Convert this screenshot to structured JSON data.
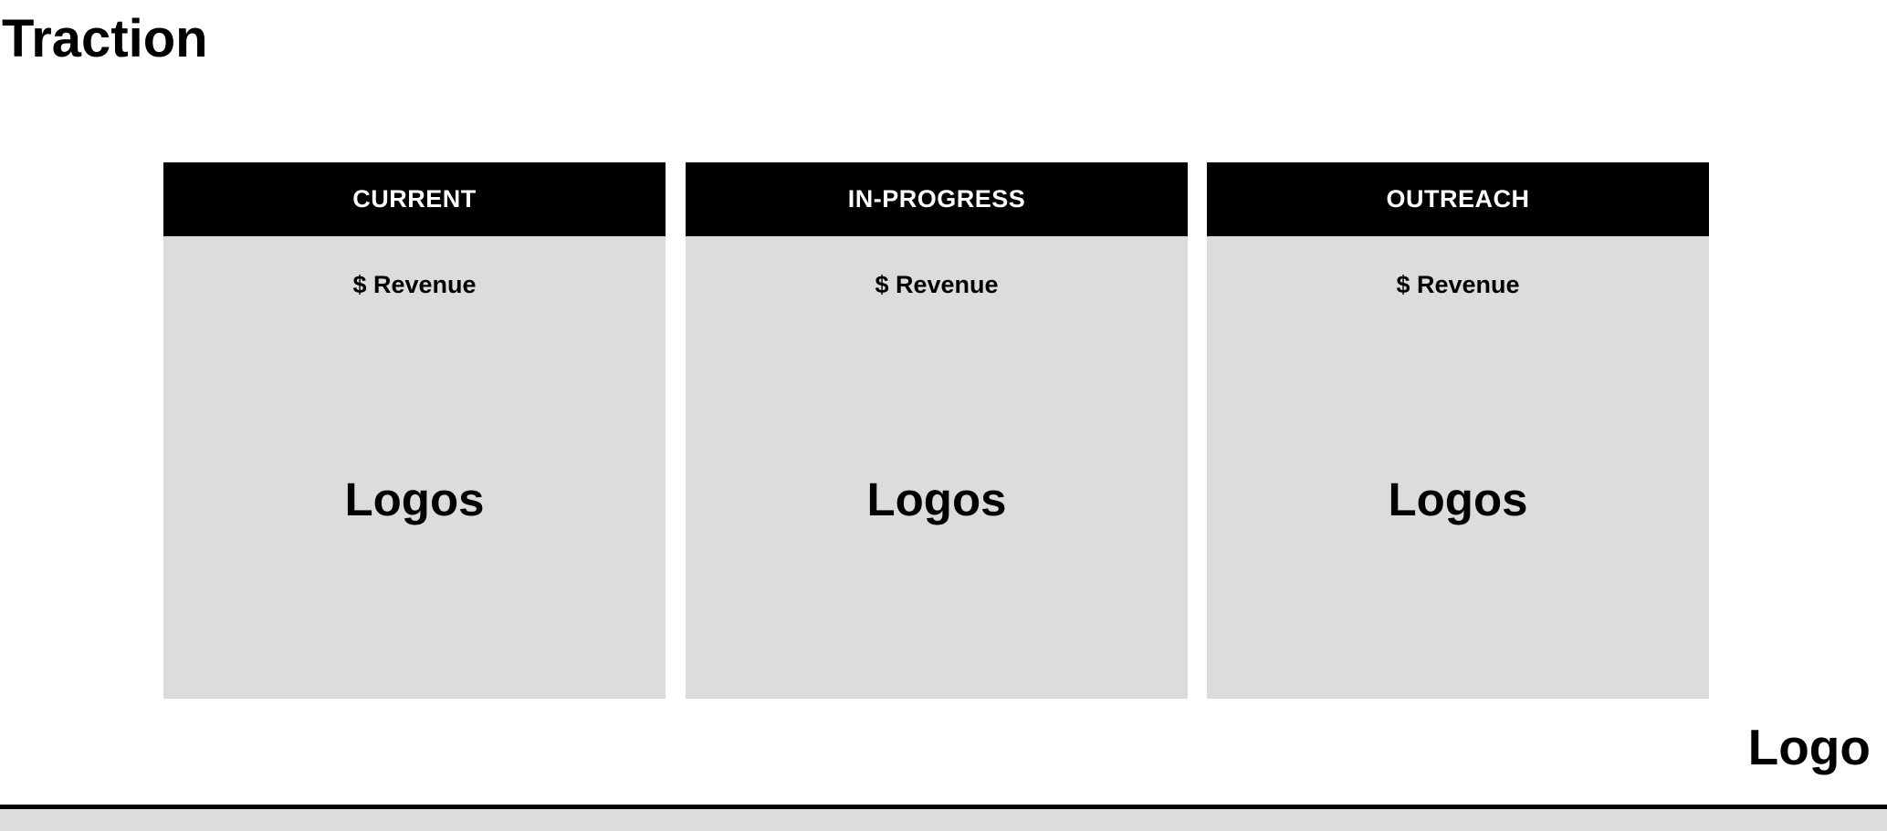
{
  "slide": {
    "title": "Traction",
    "panels": [
      {
        "header": "CURRENT",
        "revenue": "$ Revenue",
        "logos": "Logos"
      },
      {
        "header": "IN-PROGRESS",
        "revenue": "$ Revenue",
        "logos": "Logos"
      },
      {
        "header": "OUTREACH",
        "revenue": "$ Revenue",
        "logos": "Logos"
      }
    ],
    "brand_logo": "Logo"
  },
  "colors": {
    "header_background": "#000000",
    "header_text": "#ffffff",
    "panel_background": "#dddcdd",
    "text": "#000000",
    "page_background": "#ffffff"
  }
}
